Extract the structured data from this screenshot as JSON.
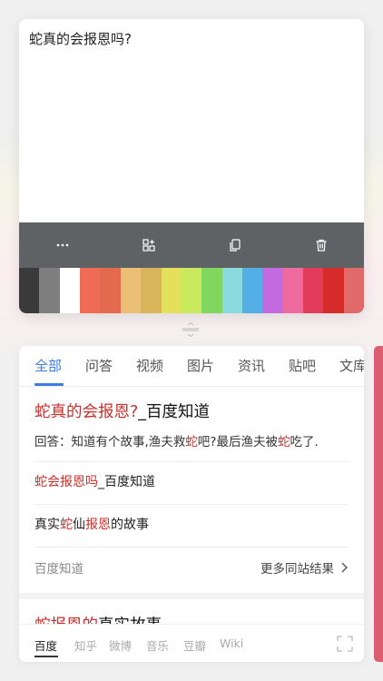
{
  "note": {
    "text": "蛇真的会报恩吗?",
    "toolbar": {
      "more_icon": "more-icon",
      "grid_icon": "grid-add-icon",
      "copy_icon": "copy-icon",
      "delete_icon": "trash-icon"
    },
    "palette": [
      "#3a3a3a",
      "#7f7f7f",
      "#ffffff",
      "#ef6b54",
      "#e36a4c",
      "#ebbf76",
      "#d8b55a",
      "#e3e159",
      "#c9ea5c",
      "#81d65f",
      "#8ad9dc",
      "#53afe6",
      "#c36ae0",
      "#ee6b9f",
      "#e33c5a",
      "#d52b2b",
      "#e06a6a"
    ]
  },
  "results": {
    "tabs": [
      "全部",
      "问答",
      "视频",
      "图片",
      "资讯",
      "贴吧",
      "文库"
    ],
    "active_tab": "全部",
    "accent_color": "#3b7ce5",
    "highlight_color": "#c9302c",
    "main": {
      "title_hl": "蛇真的会报恩?",
      "title_rest": "_百度知道",
      "snippet_a": "回答：知道有个故事,渔夫救",
      "snippet_hl1": "蛇",
      "snippet_b": "吧?最后渔夫被",
      "snippet_hl2": "蛇",
      "snippet_c": "吃了."
    },
    "links": [
      {
        "hl": "蛇会报恩吗",
        "rest": "_百度知道"
      },
      {
        "pre": "真实",
        "hl1": "蛇",
        "mid": "仙",
        "hl2": "报恩",
        "post": "的故事"
      }
    ],
    "source": "百度知道",
    "more": "更多同站结果",
    "next_title_hl": "蛇报恩的",
    "next_title_rest": "真实故事",
    "engines": [
      "百度",
      "知乎",
      "微博",
      "音乐",
      "豆瓣",
      "Wiki"
    ],
    "active_engine": "百度"
  },
  "scrollbar_color": "#dc5d70"
}
